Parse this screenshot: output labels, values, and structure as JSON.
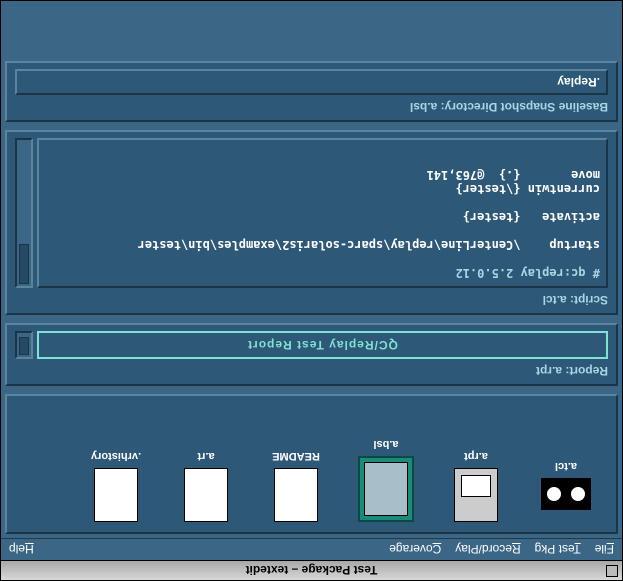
{
  "window": {
    "title": "Test Package – textedit"
  },
  "menu": {
    "file": "File",
    "testpkg": "Test Pkg",
    "recordplay": "Record/Play",
    "coverage": "Coverage",
    "help": "Help"
  },
  "files": [
    {
      "name": "a.tcl",
      "kind": "tape"
    },
    {
      "name": "a.rpt",
      "kind": "doc"
    },
    {
      "name": "a.bsl",
      "kind": "box",
      "selected": true
    },
    {
      "name": "README",
      "kind": "plain"
    },
    {
      "name": "a.rt",
      "kind": "plain"
    },
    {
      "name": ".vrhistory",
      "kind": "plain"
    }
  ],
  "report": {
    "label": "Report: a.rpt",
    "title": "QC/Replay Test Report"
  },
  "script": {
    "label": "Script: a.tcl",
    "header": "# qc:replay 2.5.0.12",
    "lines": [
      "startup    \\CenterLine\\replay\\sparc-solaris2\\examples\\bin\\tester",
      "",
      "activate   {tester}",
      "",
      "currentwin {\\tester}",
      "move       {.}  @763,141"
    ]
  },
  "baseline": {
    "label": "Baseline Snapshot Directory: a.bsl",
    "value": ".Replay"
  }
}
